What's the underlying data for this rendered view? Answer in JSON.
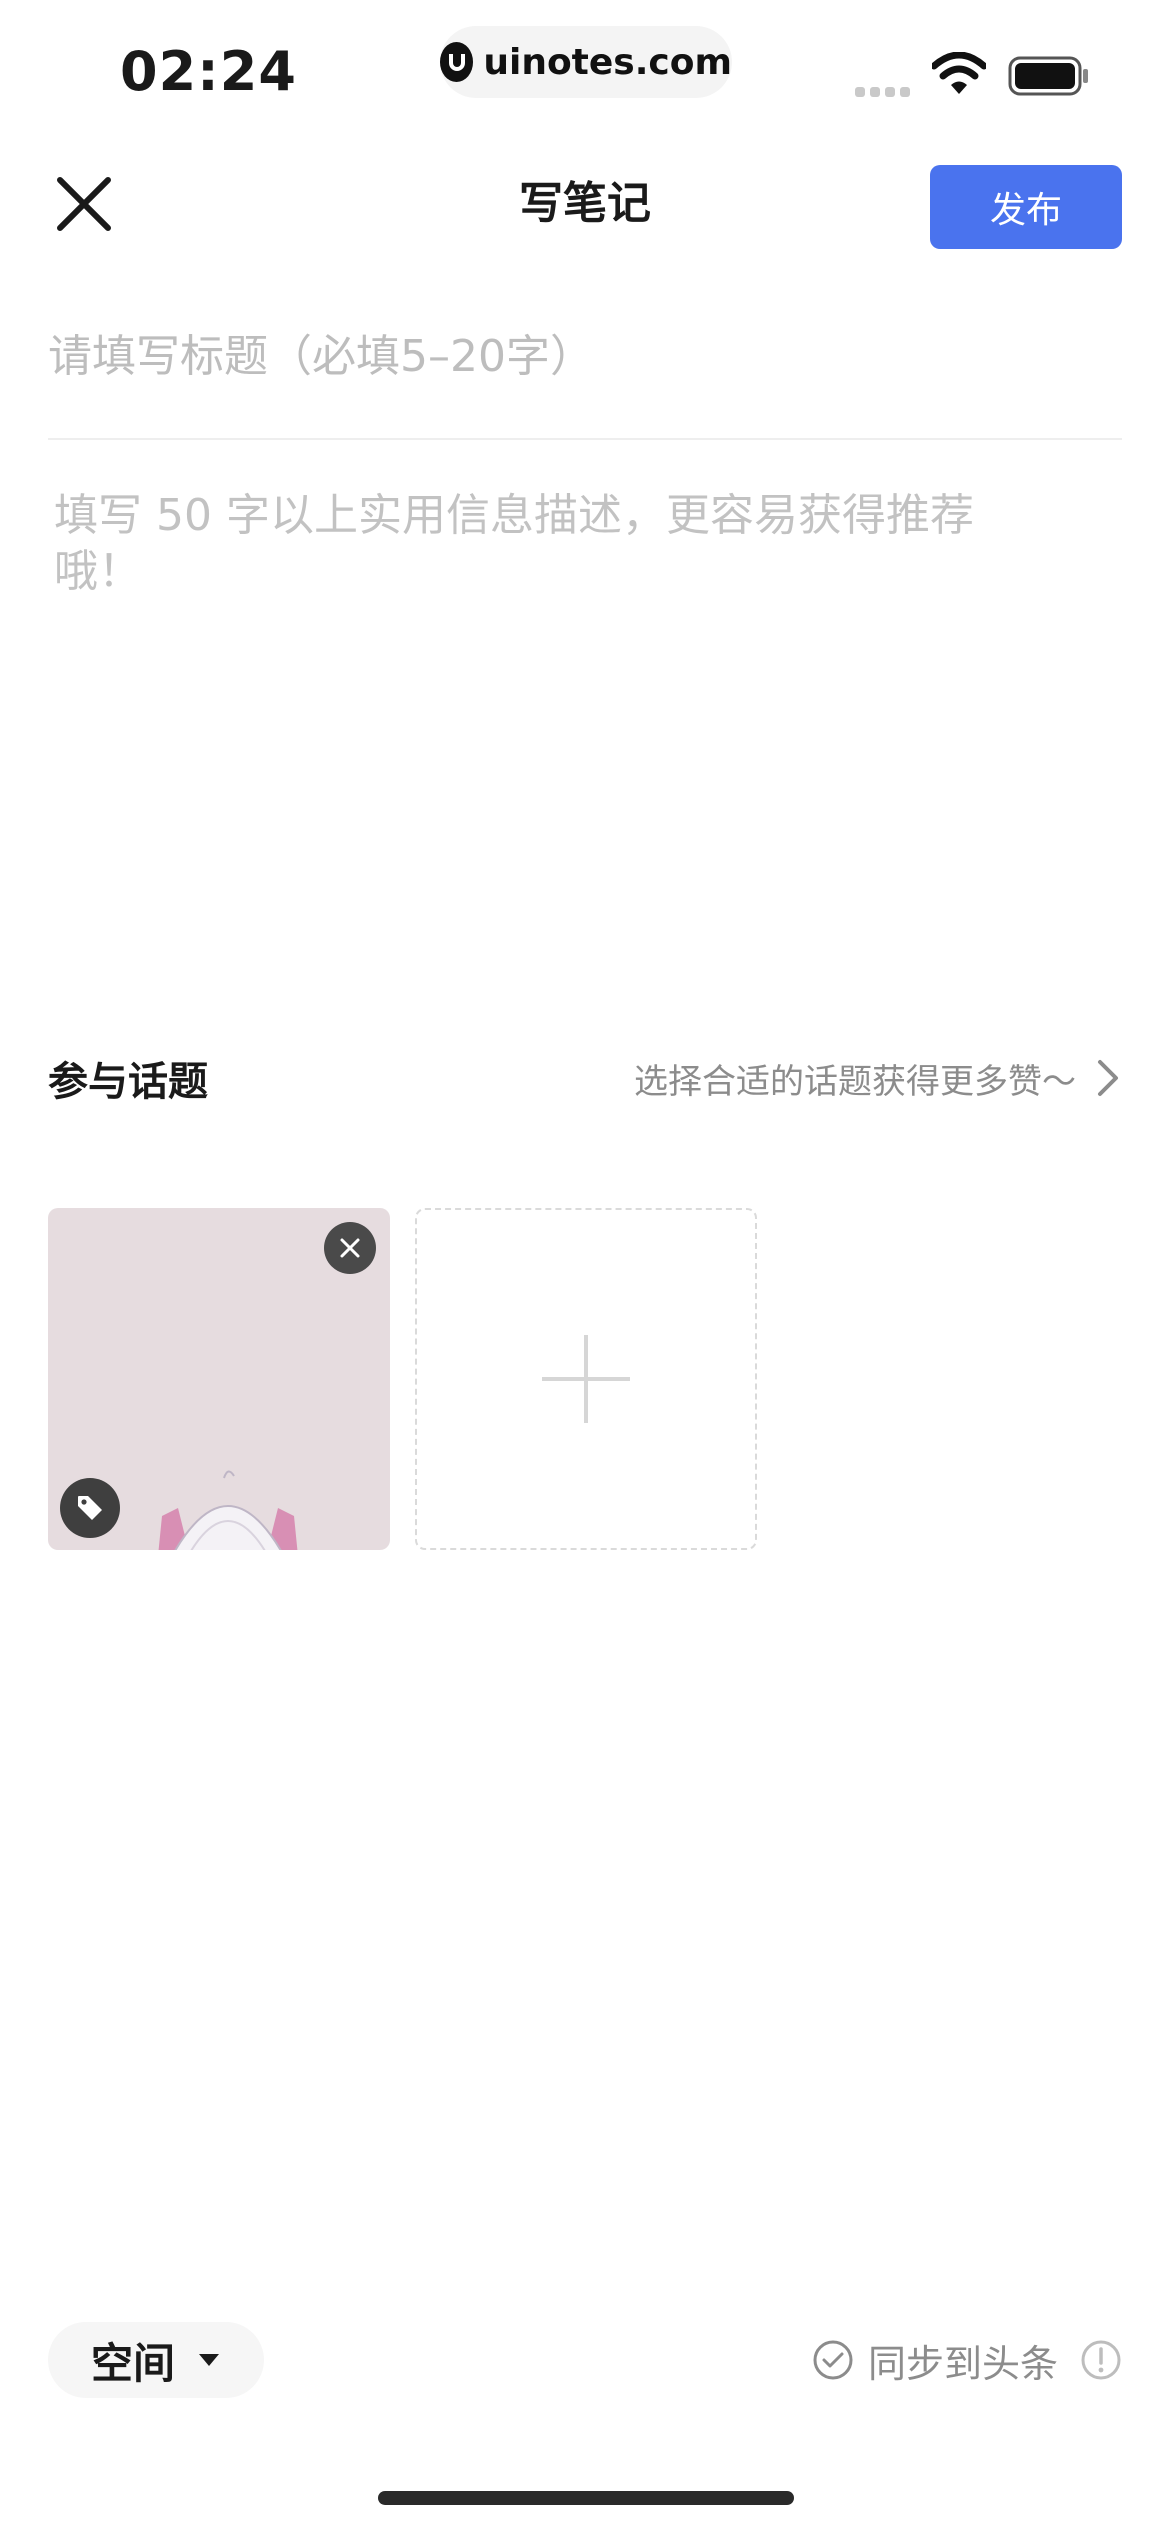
{
  "status_bar": {
    "time": "02:24",
    "url": "uinotes.com"
  },
  "header": {
    "title": "写笔记",
    "publish_label": "发布"
  },
  "editor": {
    "title_placeholder": "请填写标题（必填5–20字）",
    "body_placeholder": "填写 50 字以上实用信息描述，更容易获得推荐哦！"
  },
  "topic": {
    "label": "参与话题",
    "hint": "选择合适的话题获得更多赞～"
  },
  "images": {
    "count": 1
  },
  "footer": {
    "space_label": "空间",
    "sync_label": "同步到头条"
  },
  "colors": {
    "accent": "#4a73ee",
    "thumb_bg": "#e6dcdf"
  }
}
